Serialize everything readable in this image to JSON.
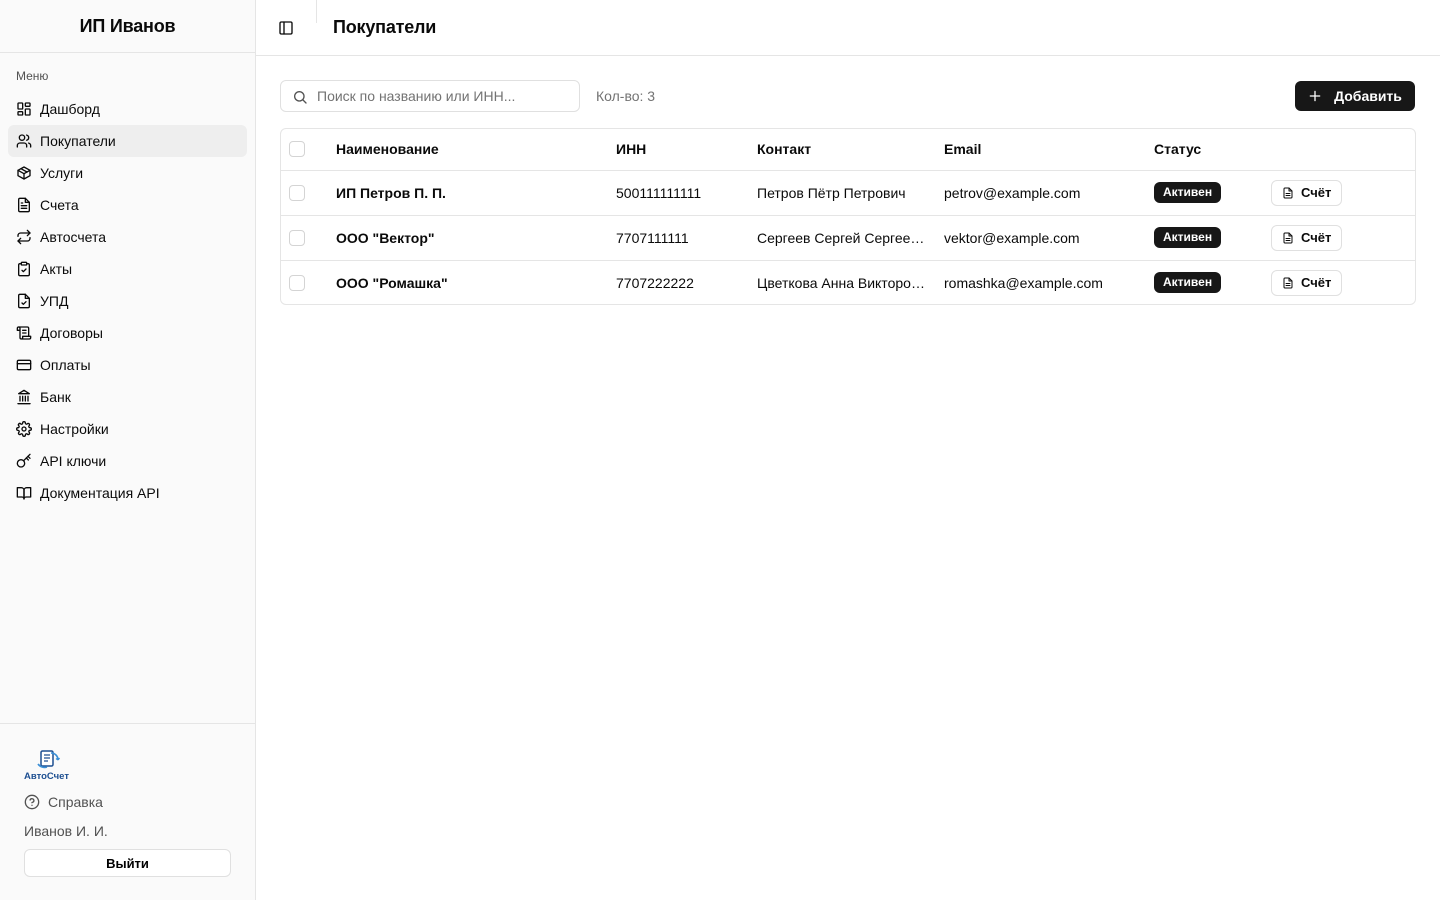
{
  "sidebar": {
    "brand": "ИП Иванов",
    "menu_label": "Меню",
    "items": [
      {
        "label": "Дашборд",
        "icon": "dashboard-icon"
      },
      {
        "label": "Покупатели",
        "icon": "users-icon",
        "active": true
      },
      {
        "label": "Услуги",
        "icon": "box-icon"
      },
      {
        "label": "Счета",
        "icon": "file-text-icon"
      },
      {
        "label": "Автосчета",
        "icon": "repeat-icon"
      },
      {
        "label": "Акты",
        "icon": "clipboard-check-icon"
      },
      {
        "label": "УПД",
        "icon": "file-check-icon"
      },
      {
        "label": "Договоры",
        "icon": "scroll-icon"
      },
      {
        "label": "Оплаты",
        "icon": "credit-card-icon"
      },
      {
        "label": "Банк",
        "icon": "bank-icon"
      },
      {
        "label": "Настройки",
        "icon": "gear-icon"
      },
      {
        "label": "API ключи",
        "icon": "key-icon"
      },
      {
        "label": "Документация API",
        "icon": "book-icon"
      }
    ],
    "logo_text": "АвтоСчет",
    "help_label": "Справка",
    "user_name": "Иванов И. И.",
    "logout_label": "Выйти"
  },
  "header": {
    "title": "Покупатели"
  },
  "toolbar": {
    "search_placeholder": "Поиск по названию или ИНН...",
    "count_label": "Кол-во: 3",
    "add_label": "Добавить"
  },
  "table": {
    "columns": [
      "Наименование",
      "ИНН",
      "Контакт",
      "Email",
      "Статус"
    ],
    "rows": [
      {
        "name": "ИП Петров П. П.",
        "inn": "500111111111",
        "contact": "Петров Пётр Петрович",
        "email": "petrov@example.com",
        "status": "Активен",
        "action": "Счёт"
      },
      {
        "name": "ООО \"Вектор\"",
        "inn": "7707111111",
        "contact": "Сергеев Сергей Сергеевич",
        "email": "vektor@example.com",
        "status": "Активен",
        "action": "Счёт"
      },
      {
        "name": "ООО \"Ромашка\"",
        "inn": "7707222222",
        "contact": "Цветкова Анна Викторовна",
        "email": "romashka@example.com",
        "status": "Активен",
        "action": "Счёт"
      }
    ]
  },
  "colors": {
    "primary": "#171717",
    "sidebar_bg": "#fafafa",
    "active_item_bg": "#eeeeee",
    "border": "#e5e5e5",
    "muted_text": "#737373",
    "logo_blue": "#1d4f91"
  }
}
